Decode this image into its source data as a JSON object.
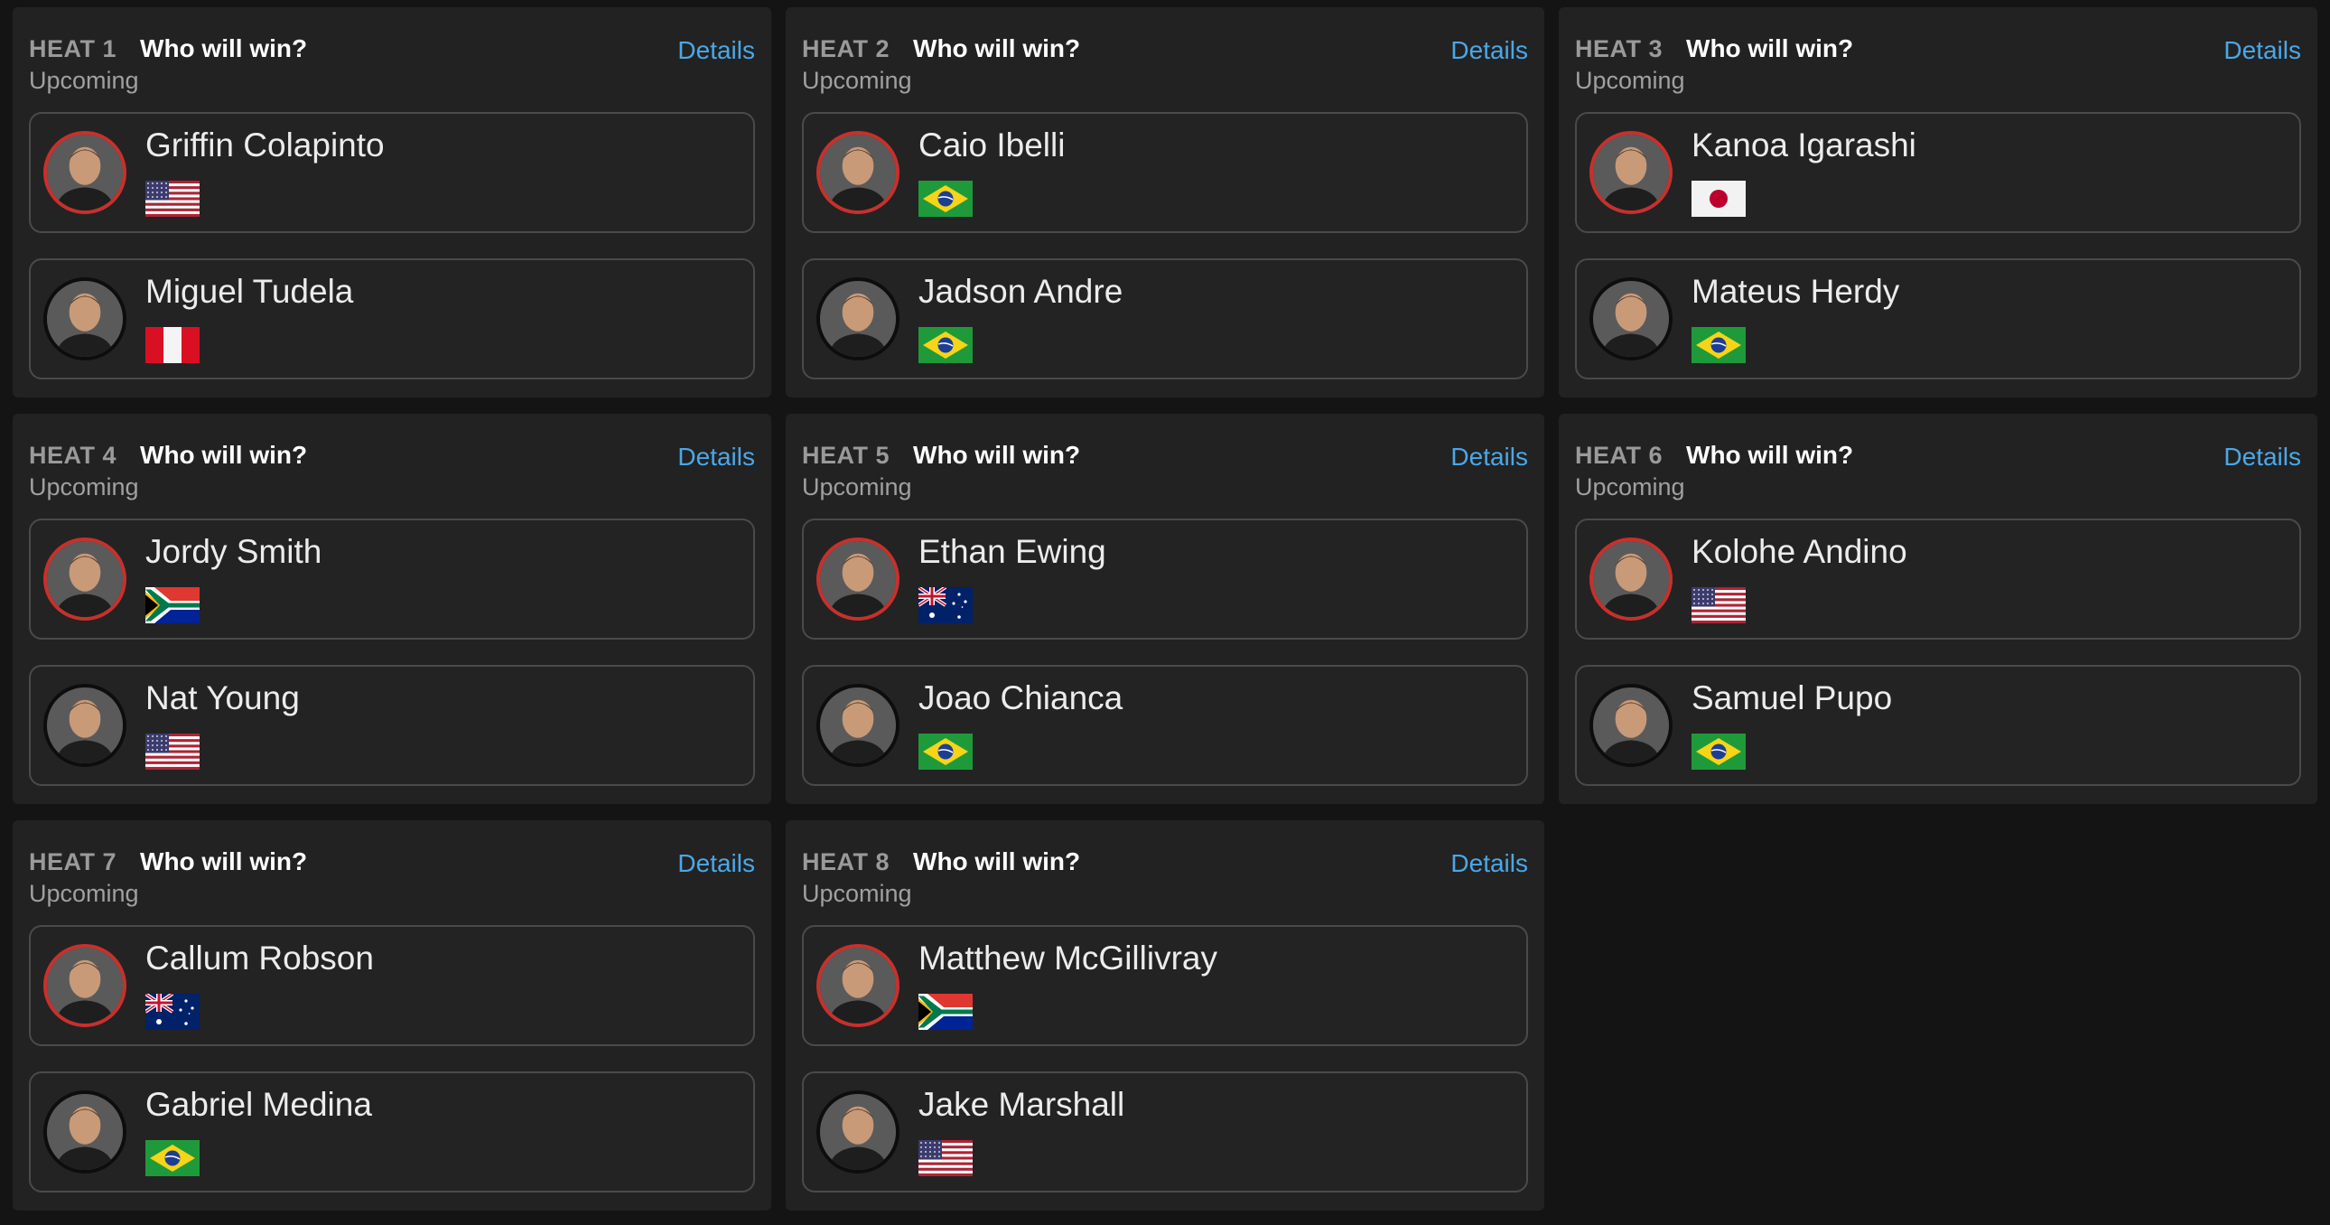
{
  "details_label": "Details",
  "heats": [
    {
      "label": "HEAT 1",
      "question": "Who will win?",
      "status": "Upcoming",
      "athletes": [
        {
          "name": "Griffin Colapinto",
          "flag": "us-flag"
        },
        {
          "name": "Miguel Tudela",
          "flag": "pe-flag"
        }
      ]
    },
    {
      "label": "HEAT 2",
      "question": "Who will win?",
      "status": "Upcoming",
      "athletes": [
        {
          "name": "Caio Ibelli",
          "flag": "br-flag"
        },
        {
          "name": "Jadson Andre",
          "flag": "br-flag"
        }
      ]
    },
    {
      "label": "HEAT 3",
      "question": "Who will win?",
      "status": "Upcoming",
      "athletes": [
        {
          "name": "Kanoa Igarashi",
          "flag": "jp-flag"
        },
        {
          "name": "Mateus Herdy",
          "flag": "br-flag"
        }
      ]
    },
    {
      "label": "HEAT 4",
      "question": "Who will win?",
      "status": "Upcoming",
      "athletes": [
        {
          "name": "Jordy Smith",
          "flag": "za-flag"
        },
        {
          "name": "Nat Young",
          "flag": "us-flag"
        }
      ]
    },
    {
      "label": "HEAT 5",
      "question": "Who will win?",
      "status": "Upcoming",
      "athletes": [
        {
          "name": "Ethan Ewing",
          "flag": "au-flag"
        },
        {
          "name": "Joao Chianca",
          "flag": "br-flag"
        }
      ]
    },
    {
      "label": "HEAT 6",
      "question": "Who will win?",
      "status": "Upcoming",
      "athletes": [
        {
          "name": "Kolohe Andino",
          "flag": "us-flag"
        },
        {
          "name": "Samuel Pupo",
          "flag": "br-flag"
        }
      ]
    },
    {
      "label": "HEAT 7",
      "question": "Who will win?",
      "status": "Upcoming",
      "athletes": [
        {
          "name": "Callum Robson",
          "flag": "au-flag"
        },
        {
          "name": "Gabriel Medina",
          "flag": "br-flag"
        }
      ]
    },
    {
      "label": "HEAT 8",
      "question": "Who will win?",
      "status": "Upcoming",
      "athletes": [
        {
          "name": "Matthew McGillivray",
          "flag": "za-flag"
        },
        {
          "name": "Jake Marshall",
          "flag": "us-flag"
        }
      ]
    }
  ],
  "colors": {
    "background": "#141414",
    "card": "#222222",
    "link": "#4aa8e8",
    "avatar_ring_first": "#c8302c",
    "avatar_ring_second": "#0d0d0d"
  }
}
